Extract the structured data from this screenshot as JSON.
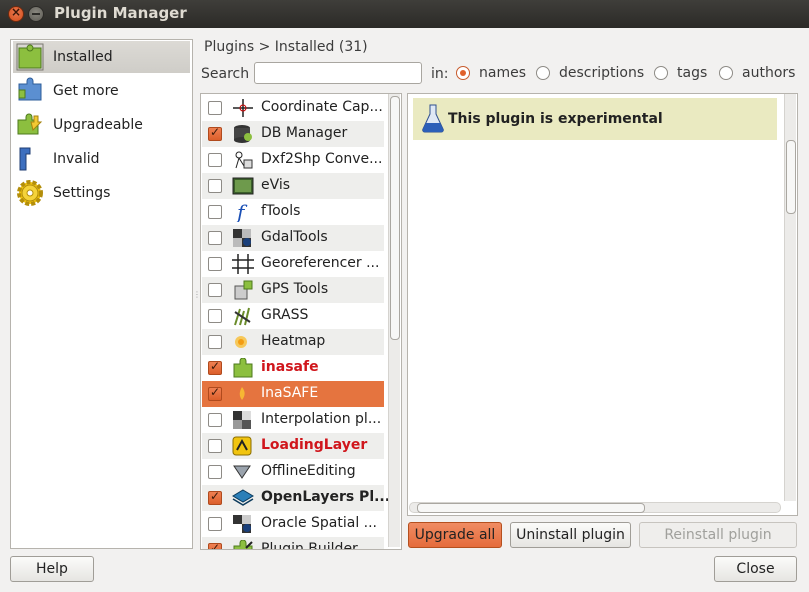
{
  "window": {
    "title": "Plugin Manager"
  },
  "sidebar": {
    "items": [
      {
        "label": "Installed",
        "icon": "puzzle-installed-icon",
        "selected": true
      },
      {
        "label": "Get more",
        "icon": "puzzle-download-icon"
      },
      {
        "label": "Upgradeable",
        "icon": "puzzle-upgrade-icon"
      },
      {
        "label": "Invalid",
        "icon": "puzzle-invalid-icon"
      },
      {
        "label": "Settings",
        "icon": "gear-icon"
      }
    ]
  },
  "header": {
    "breadcrumb": "Plugins > Installed (31)"
  },
  "search": {
    "label": "Search",
    "value": "",
    "in_label": "in:",
    "options": [
      "names",
      "descriptions",
      "tags",
      "authors"
    ],
    "selected": "names"
  },
  "plugins": [
    {
      "name": "Coordinate Cap...",
      "checked": false,
      "icon": "crosshair-icon"
    },
    {
      "name": "DB Manager",
      "checked": true,
      "icon": "database-icon"
    },
    {
      "name": "Dxf2Shp Conve...",
      "checked": false,
      "icon": "dxf-convert-icon"
    },
    {
      "name": "eVis",
      "checked": false,
      "icon": "evis-icon"
    },
    {
      "name": "fTools",
      "checked": false,
      "icon": "ftools-icon"
    },
    {
      "name": "GdalTools",
      "checked": false,
      "icon": "gdal-icon"
    },
    {
      "name": "Georeferencer ...",
      "checked": false,
      "icon": "grid-icon"
    },
    {
      "name": "GPS Tools",
      "checked": false,
      "icon": "gps-icon"
    },
    {
      "name": "GRASS",
      "checked": false,
      "icon": "grass-icon"
    },
    {
      "name": "Heatmap",
      "checked": false,
      "icon": "heatmap-icon"
    },
    {
      "name": "inasafe",
      "checked": true,
      "icon": "puzzle-icon",
      "style": "red"
    },
    {
      "name": "InaSAFE",
      "checked": true,
      "icon": "flame-icon",
      "selected": true
    },
    {
      "name": "Interpolation pl...",
      "checked": false,
      "icon": "interpolation-icon"
    },
    {
      "name": "LoadingLayer",
      "checked": false,
      "icon": "loading-layer-icon",
      "style": "red"
    },
    {
      "name": "OfflineEditing",
      "checked": false,
      "icon": "offline-editing-icon"
    },
    {
      "name": "OpenLayers Pl...",
      "checked": true,
      "icon": "openlayers-icon",
      "style": "bold"
    },
    {
      "name": "Oracle Spatial ...",
      "checked": false,
      "icon": "oracle-icon"
    },
    {
      "name": "Plugin Builder",
      "checked": true,
      "icon": "plugin-builder-icon"
    }
  ],
  "detail": {
    "experimental_text": "This plugin is experimental",
    "icon": "flask-icon"
  },
  "buttons": {
    "upgrade_all": "Upgrade all",
    "uninstall": "Uninstall plugin",
    "reinstall": "Reinstall plugin",
    "help": "Help",
    "close": "Close"
  },
  "colors": {
    "accent": "#e5743f",
    "experimental_bg": "#eaeac1",
    "error_text": "#d0161c"
  }
}
